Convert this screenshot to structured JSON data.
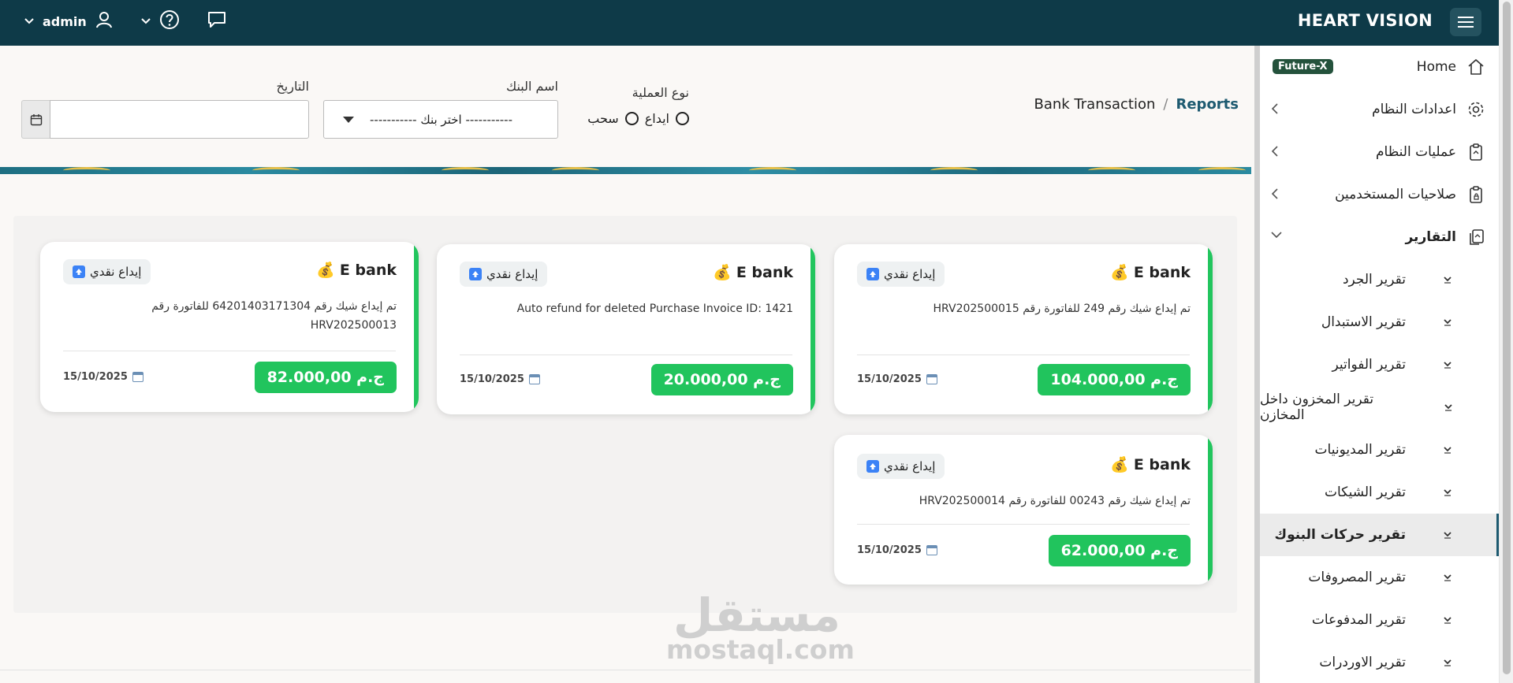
{
  "topbar": {
    "brand": "HEART VISION",
    "user_name": "admin"
  },
  "breadcrumb": {
    "current": "Bank Transaction",
    "separator": "/",
    "link": "Reports"
  },
  "filters": {
    "operation_type_label": "نوع العملية",
    "deposit_label": "ايداع",
    "withdraw_label": "سحب",
    "bank_label": "اسم البنك",
    "bank_select_value": "----------- اختر بنك -----------",
    "date_label": "التاريخ",
    "date_value": ""
  },
  "sidebar": {
    "home": "Home",
    "badge": "Future-X",
    "items": [
      {
        "label": "اعدادات النظام"
      },
      {
        "label": "عمليات النظام"
      },
      {
        "label": "صلاحيات المستخدمين"
      },
      {
        "label": "التقارير"
      }
    ],
    "sub_items": [
      {
        "label": "تقرير الجرد"
      },
      {
        "label": "تقرير الاستبدال"
      },
      {
        "label": "تقرير الفواتير"
      },
      {
        "label": "تقرير المخزون داخل المخازن"
      },
      {
        "label": "تقرير المديونيات"
      },
      {
        "label": "تقرير الشيكات"
      },
      {
        "label": "تقرير حركات البنوك"
      },
      {
        "label": "تقرير المصروفات"
      },
      {
        "label": "تقرير المدفوعات"
      },
      {
        "label": "تقرير الاوردرات"
      }
    ]
  },
  "cards": [
    {
      "bank": "E bank",
      "tag": "إيداع نقدي",
      "desc": "تم إيداع شيك رقم 249 للفاتورة رقم HRV202500015",
      "amount": "104.000,00 ج.م",
      "date": "15/10/2025"
    },
    {
      "bank": "E bank",
      "tag": "إيداع نقدي",
      "desc": "Auto refund for deleted Purchase Invoice ID: 1421",
      "amount": "20.000,00 ج.م",
      "date": "15/10/2025"
    },
    {
      "bank": "E bank",
      "tag": "إيداع نقدي",
      "desc": "تم إيداع شيك رقم 64201403171304 للفاتورة رقم HRV202500013",
      "amount": "82.000,00 ج.م",
      "date": "15/10/2025"
    },
    {
      "bank": "E bank",
      "tag": "إيداع نقدي",
      "desc": "تم إيداع شيك رقم 00243 للفاتورة رقم HRV202500014",
      "amount": "62.000,00 ج.م",
      "date": "15/10/2025"
    }
  ],
  "watermark": {
    "arabic": "مستقل",
    "latin": "mostaql.com"
  },
  "colors": {
    "topbar": "#0e3a48",
    "accent": "#1d5a70",
    "amount_green": "#21c45d"
  }
}
